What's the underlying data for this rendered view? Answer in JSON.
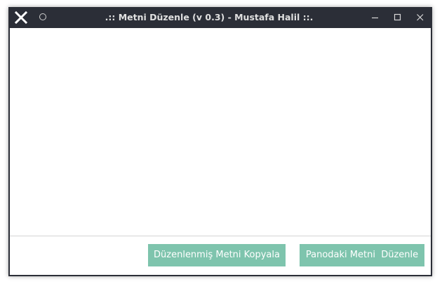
{
  "window": {
    "title": ".:: Metni Düzenle (v 0.3) - Mustafa Halil ::.",
    "icons": {
      "app": "x-logo-icon",
      "sticky": "circle-icon",
      "minimize": "minimize-icon",
      "maximize": "maximize-icon",
      "close": "close-icon"
    }
  },
  "editor": {
    "value": ""
  },
  "buttons": {
    "copy_label": "Düzenlenmiş Metni Kopyala",
    "edit_label": "Panodaki Metni  Düzenle",
    "color": "#7ec4ad"
  }
}
